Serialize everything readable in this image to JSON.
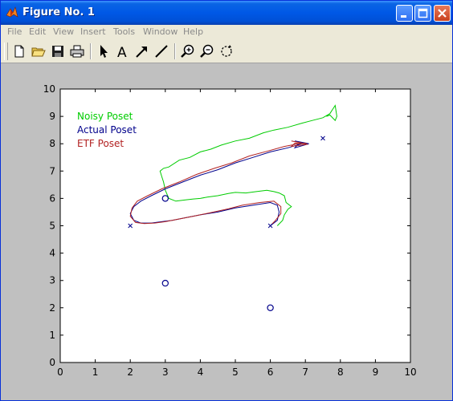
{
  "window": {
    "title": "Figure No. 1"
  },
  "menu": [
    "File",
    "Edit",
    "View",
    "Insert",
    "Tools",
    "Window",
    "Help"
  ],
  "toolbar": {
    "tools": [
      "new-file-icon",
      "open-folder-icon",
      "save-icon",
      "print-icon",
      "pointer-arrow-icon",
      "text-insert-icon",
      "arrow-insert-icon",
      "line-insert-icon",
      "zoom-in-icon",
      "zoom-out-icon",
      "rotate-3d-icon"
    ],
    "text_tool_glyph": "A"
  },
  "colors": {
    "noisy": "#00cc00",
    "actual": "#00008b",
    "etf": "#b22222",
    "figure_bg": "#c0c0c0",
    "axes_bg": "#ffffff",
    "marker": "#00008b"
  },
  "chart_data": {
    "type": "line",
    "xlim": [
      0,
      10
    ],
    "ylim": [
      0,
      10
    ],
    "xticks": [
      "0",
      "1",
      "2",
      "3",
      "4",
      "5",
      "6",
      "7",
      "8",
      "9",
      "10"
    ],
    "yticks": [
      "0",
      "1",
      "2",
      "3",
      "4",
      "5",
      "6",
      "7",
      "8",
      "9",
      "10"
    ],
    "grid": false,
    "legend_position": "top-left",
    "series": [
      {
        "name": "Noisy Poset",
        "color": "#00cc00",
        "x": [
          6.2,
          6.35,
          6.4,
          6.5,
          6.6,
          6.45,
          6.4,
          6.25,
          6.1,
          5.9,
          5.6,
          5.3,
          5.0,
          4.8,
          4.5,
          4.2,
          4.0,
          3.8,
          3.6,
          3.3,
          3.1,
          3.0,
          2.95,
          2.9,
          2.85,
          2.95,
          3.1,
          3.4,
          3.7,
          4.0,
          4.3,
          4.6,
          5.0,
          5.4,
          5.8,
          6.1,
          6.5,
          6.9,
          7.2,
          7.5,
          7.7,
          7.8,
          7.85,
          7.9,
          7.85,
          7.7,
          7.6
        ],
        "y": [
          5.0,
          5.2,
          5.4,
          5.6,
          5.7,
          5.85,
          6.1,
          6.2,
          6.25,
          6.3,
          6.25,
          6.2,
          6.22,
          6.18,
          6.1,
          6.05,
          6.0,
          5.98,
          5.95,
          5.9,
          6.0,
          6.3,
          6.6,
          6.8,
          7.0,
          7.1,
          7.15,
          7.4,
          7.5,
          7.7,
          7.8,
          7.95,
          8.1,
          8.2,
          8.4,
          8.5,
          8.6,
          8.75,
          8.85,
          8.95,
          9.1,
          9.3,
          9.4,
          9.0,
          8.85,
          9.05,
          9.0
        ]
      },
      {
        "name": "Actual Poset",
        "color": "#00008b",
        "x": [
          6.0,
          6.2,
          6.25,
          6.2,
          6.0,
          5.5,
          5.0,
          4.5,
          4.0,
          3.6,
          3.2,
          2.9,
          2.6,
          2.3,
          2.1,
          2.0,
          2.1,
          2.3,
          2.6,
          3.0,
          3.5,
          4.0,
          4.5,
          5.0,
          5.5,
          6.0,
          6.5,
          6.9,
          7.1,
          6.7,
          6.8,
          7.1,
          6.7
        ],
        "y": [
          5.0,
          5.2,
          5.5,
          5.75,
          5.85,
          5.75,
          5.65,
          5.5,
          5.4,
          5.3,
          5.2,
          5.15,
          5.1,
          5.1,
          5.2,
          5.45,
          5.7,
          5.9,
          6.1,
          6.35,
          6.6,
          6.85,
          7.05,
          7.3,
          7.5,
          7.7,
          7.85,
          8.0,
          8.0,
          7.85,
          8.0,
          8.0,
          8.1
        ]
      },
      {
        "name": "ETF Poset",
        "color": "#b22222",
        "x": [
          6.0,
          6.15,
          6.3,
          6.3,
          6.1,
          5.7,
          5.2,
          4.8,
          4.3,
          3.8,
          3.4,
          3.0,
          2.7,
          2.4,
          2.15,
          2.0,
          2.05,
          2.2,
          2.5,
          2.9,
          3.4,
          3.9,
          4.4,
          4.9,
          5.4,
          5.9,
          6.4,
          6.8,
          7.0,
          7.05,
          6.6,
          6.7,
          7.0,
          6.6
        ],
        "y": [
          5.0,
          5.2,
          5.45,
          5.7,
          5.9,
          5.85,
          5.75,
          5.62,
          5.48,
          5.35,
          5.25,
          5.15,
          5.1,
          5.08,
          5.12,
          5.35,
          5.65,
          5.9,
          6.1,
          6.35,
          6.6,
          6.88,
          7.1,
          7.3,
          7.55,
          7.72,
          7.9,
          8.0,
          8.02,
          7.98,
          7.9,
          8.02,
          8.0,
          8.1
        ]
      }
    ],
    "markers": {
      "circles": [
        [
          3.0,
          6.0
        ],
        [
          3.0,
          2.9
        ],
        [
          6.0,
          2.0
        ]
      ],
      "crosses": [
        [
          2.0,
          5.0
        ],
        [
          6.0,
          5.0
        ],
        [
          7.5,
          8.2
        ]
      ]
    }
  }
}
